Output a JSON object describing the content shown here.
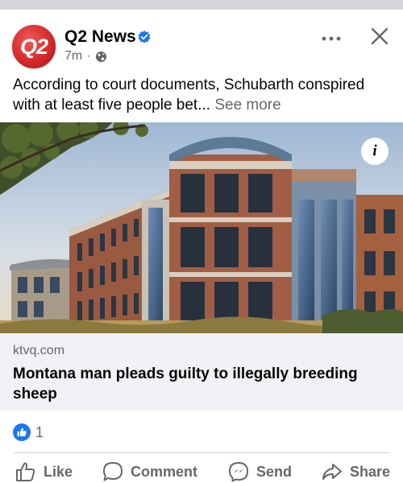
{
  "post": {
    "page_name": "Q2 News",
    "avatar_text": "Q2",
    "time": "7m",
    "separator": "·",
    "text": "According to court documents, Schubarth conspired with at least five people bet...",
    "see_more": "See more"
  },
  "link": {
    "domain": "ktvq.com",
    "headline": "Montana man pleads guilty to illegally breeding sheep"
  },
  "reactions": {
    "count": "1"
  },
  "actions": {
    "like": "Like",
    "comment": "Comment",
    "send": "Send",
    "share": "Share"
  },
  "icons": {
    "verified": "verified-badge-icon",
    "audience": "globe-icon",
    "more": "more-options-icon",
    "close": "close-icon",
    "info": "info-icon"
  },
  "colors": {
    "brand_red": "#d42a2a",
    "facebook_blue": "#1877f2",
    "muted_text": "#65676b",
    "link_box_bg": "#f0f2f5"
  }
}
